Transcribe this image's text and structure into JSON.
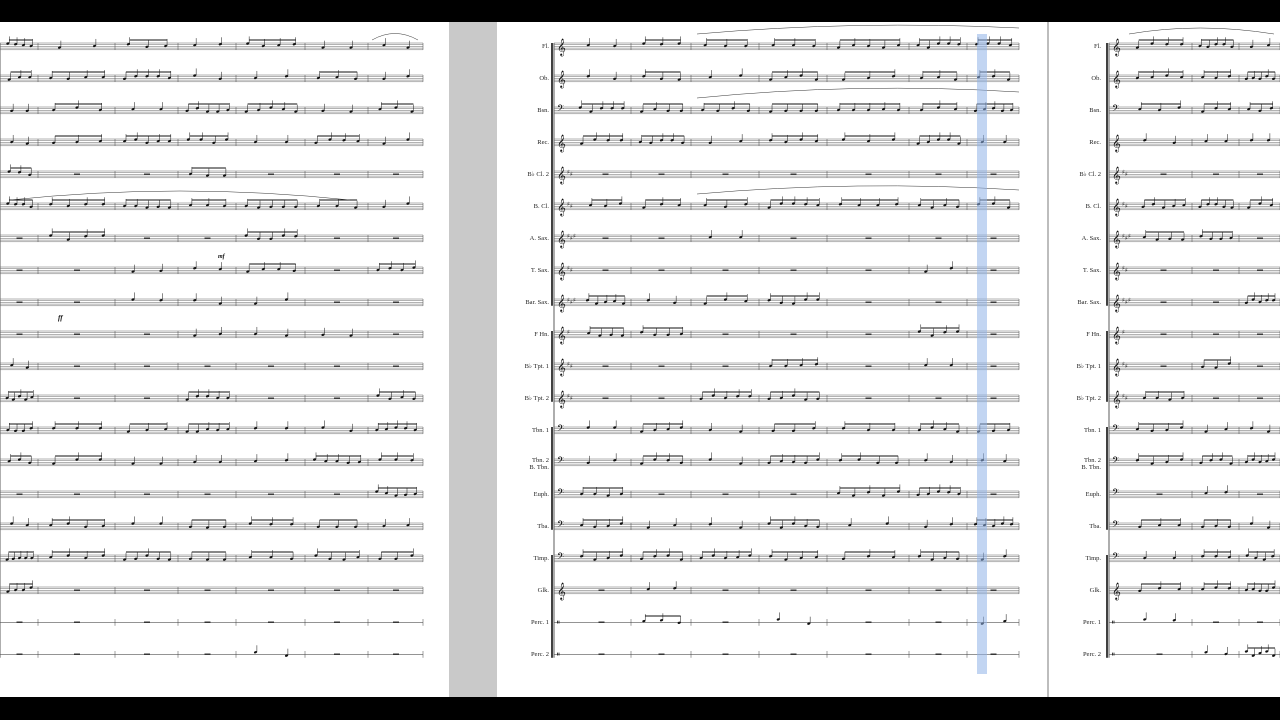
{
  "app": {
    "name": "music notation score viewer"
  },
  "instruments": [
    {
      "short": "Fl.",
      "kind": "treble",
      "key": "",
      "rest": false
    },
    {
      "short": "Ob.",
      "kind": "treble",
      "key": "",
      "rest": false
    },
    {
      "short": "Bsn.",
      "kind": "bass",
      "key": "",
      "rest": false
    },
    {
      "short": "Rec.",
      "kind": "treble",
      "key": "",
      "rest": false
    },
    {
      "short": "B♭ Cl. 2",
      "kind": "treble",
      "key": "##",
      "rest": true
    },
    {
      "short": "B. Cl.",
      "kind": "treble",
      "key": "##",
      "rest": false
    },
    {
      "short": "A. Sax.",
      "kind": "treble",
      "key": "###",
      "rest": true
    },
    {
      "short": "T. Sax.",
      "kind": "treble",
      "key": "##",
      "rest": true
    },
    {
      "short": "Bar. Sax.",
      "kind": "treble",
      "key": "###",
      "rest": true
    },
    {
      "short": "F Hn.",
      "kind": "treble",
      "key": "#",
      "rest": true
    },
    {
      "short": "B♭ Tpt. 1",
      "kind": "treble",
      "key": "##",
      "rest": true
    },
    {
      "short": "B♭ Tpt. 2",
      "kind": "treble",
      "key": "##",
      "rest": true
    },
    {
      "short": "Tbn. 1",
      "kind": "bass",
      "key": "",
      "rest": false
    },
    {
      "short": "Tbn. 2\nB. Tbn.",
      "kind": "bass",
      "key": "",
      "rest": false
    },
    {
      "short": "Euph.",
      "kind": "bass",
      "key": "",
      "rest": true
    },
    {
      "short": "Tba.",
      "kind": "bass",
      "key": "",
      "rest": false
    },
    {
      "short": "Timp.",
      "kind": "bass",
      "key": "",
      "rest": false
    },
    {
      "short": "Glk.",
      "kind": "treble",
      "key": "",
      "rest": true
    },
    {
      "short": "Perc. 1",
      "kind": "perc",
      "key": "",
      "rest": true
    },
    {
      "short": "Perc. 2",
      "kind": "perc",
      "key": "",
      "rest": true
    }
  ],
  "dynamics": {
    "left_ff": "ff",
    "left_mf": "mf"
  },
  "playback": {
    "cursor_color": "#8fb3e8"
  }
}
